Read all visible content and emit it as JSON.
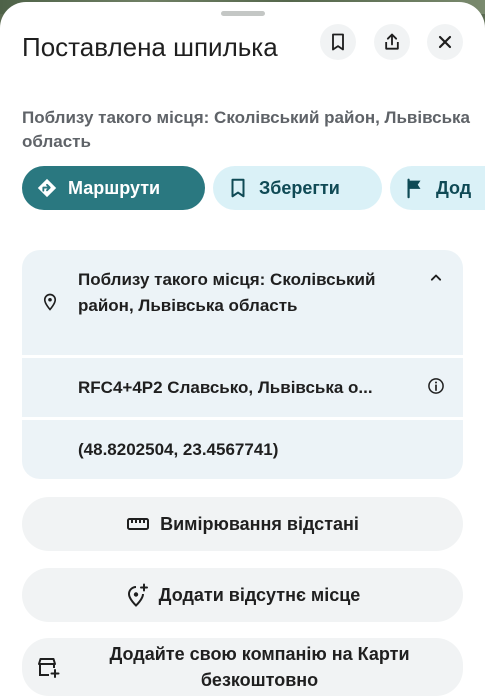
{
  "sheet": {
    "title": "Поставлена шпилька",
    "subtitle": "Поблизу такого місця: Сколівський район, Львівська область"
  },
  "header_icons": {
    "bookmark": "bookmark-icon",
    "share": "share-icon",
    "close": "close-icon"
  },
  "chips": {
    "directions": "Маршрути",
    "save": "Зберегти",
    "add_label": "Дод"
  },
  "info": {
    "address": "Поблизу такого місця: Сколівський район, Львівська область",
    "plus_code": "RFC4+4P2 Славсько, Львівська о...",
    "coordinates": "(48.8202504, 23.4567741)"
  },
  "actions": {
    "measure": "Вимірювання відстані",
    "add_missing": "Додати відсутнє місце",
    "add_business": "Додайте свою компанію на Карти безкоштовно"
  },
  "colors": {
    "primary_chip": "#2a7880",
    "secondary_chip": "#daf1f7",
    "info_row": "#ecf3f7",
    "action_bg": "#f1f3f4"
  }
}
